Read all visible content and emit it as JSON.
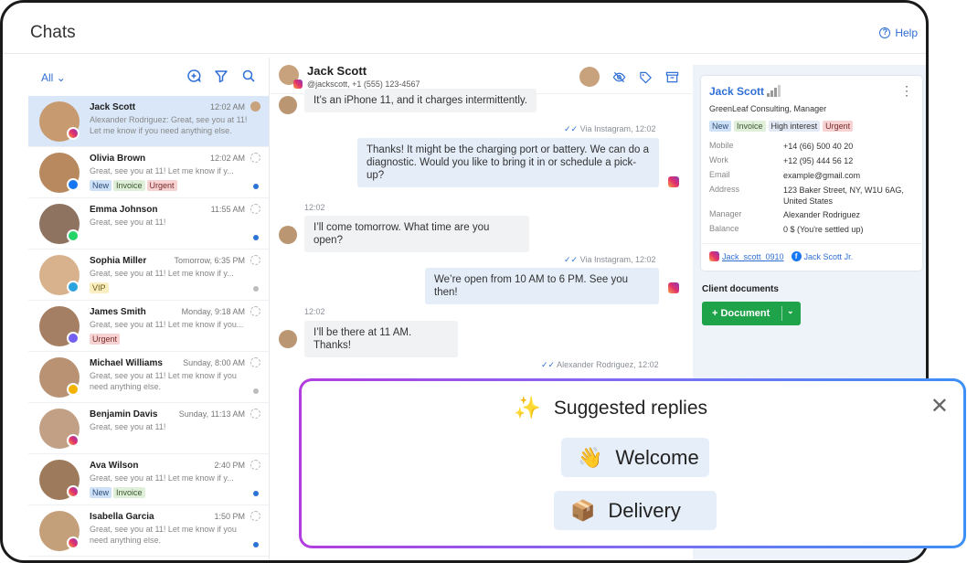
{
  "header": {
    "title": "Chats",
    "help_label": "Help"
  },
  "left": {
    "filter_label": "All",
    "chats": [
      {
        "name": "Jack Scott",
        "time": "12:02 AM",
        "msg": "Alexander Rodriguez: Great, see you at 11! Let me know if you need anything else.",
        "tags": [],
        "channel": "instagram",
        "active": true,
        "dot": ""
      },
      {
        "name": "Olivia Brown",
        "time": "12:02 AM",
        "msg": "Great, see you at 11! Let me know if y...",
        "tags": [
          "New",
          "Invoice",
          "Urgent"
        ],
        "channel": "facebook",
        "active": false,
        "dot": "#2a74d8"
      },
      {
        "name": "Emma Johnson",
        "time": "11:55 AM",
        "msg": "Great, see you at 11!",
        "tags": [],
        "channel": "whatsapp",
        "active": false,
        "dot": "#2a74d8"
      },
      {
        "name": "Sophia Miller",
        "time": "Tomorrow, 6:35 PM",
        "msg": "Great, see you at 11! Let me know if y...",
        "tags": [
          "VIP"
        ],
        "channel": "telegram",
        "active": false,
        "dot": "#bcbcbc"
      },
      {
        "name": "James Smith",
        "time": "Monday, 9:18 AM",
        "msg": "Great, see you at 11! Let me know if you...",
        "tags": [
          "Urgent"
        ],
        "channel": "viber",
        "active": false,
        "dot": ""
      },
      {
        "name": "Michael Williams",
        "time": "Sunday, 8:00 AM",
        "msg": "Great, see you at 11! Let me know if you need anything else.",
        "tags": [],
        "channel": "other",
        "active": false,
        "dot": "#bcbcbc"
      },
      {
        "name": "Benjamin Davis",
        "time": "Sunday, 11:13 AM",
        "msg": "Great, see you at 11!",
        "tags": [],
        "channel": "instagram",
        "active": false,
        "dot": ""
      },
      {
        "name": "Ava Wilson",
        "time": "2:40 PM",
        "msg": "Great, see you at 11! Let me know if y...",
        "tags": [
          "New",
          "Invoice"
        ],
        "channel": "instagram",
        "active": false,
        "dot": "#2a74d8"
      },
      {
        "name": "Isabella Garcia",
        "time": "1:50 PM",
        "msg": "Great, see you at 11! Let me know if you need anything else.",
        "tags": [],
        "channel": "instagram",
        "active": false,
        "dot": "#2a74d8"
      }
    ]
  },
  "conversation": {
    "name": "Jack Scott",
    "sub": "@jackscott, +1 (555) 123-4567",
    "m1": "It’s an iPhone 11, and it charges intermittently.",
    "meta1": "Via Instagram, 12:02",
    "m2": "Thanks! It might be the charging port or battery. We can do a diagnostic. Would you like to bring it in or schedule a pick-up?",
    "t1": "12:02",
    "m3": "I’ll come tomorrow. What time are you open?",
    "meta2": "Via Instagram, 12:02",
    "m4": "We’re open from 10 AM to 6 PM. See you then!",
    "t2": "12:02",
    "m5": "I’ll be there at 11 AM. Thanks!",
    "meta3": "Alexander Rodriguez, 12:02"
  },
  "contact": {
    "name": "Jack Scott",
    "company": "GreenLeaf Consulting, Manager",
    "tags": [
      "New",
      "Invoice",
      "High interest",
      "Urgent"
    ],
    "fields": [
      {
        "k": "Mobile",
        "v": "+14 (66) 500 40 20"
      },
      {
        "k": "Work",
        "v": "+12 (95) 444 56 12"
      },
      {
        "k": "Email",
        "v": "example@gmail.com"
      },
      {
        "k": "Address",
        "v": "123 Baker Street, NY, W1U 6AG, United States"
      },
      {
        "k": "Manager",
        "v": "Alexander Rodriguez"
      },
      {
        "k": "Balance",
        "v": "0 $ (You're settled up)"
      }
    ],
    "instagram": "Jack_scott_0910",
    "facebook": "Jack Scott Jr.",
    "docs_label": "Client documents",
    "doc_button": "+ Document"
  },
  "overlay": {
    "title": "Suggested replies",
    "replies": [
      "Welcome",
      "Delivery"
    ]
  }
}
